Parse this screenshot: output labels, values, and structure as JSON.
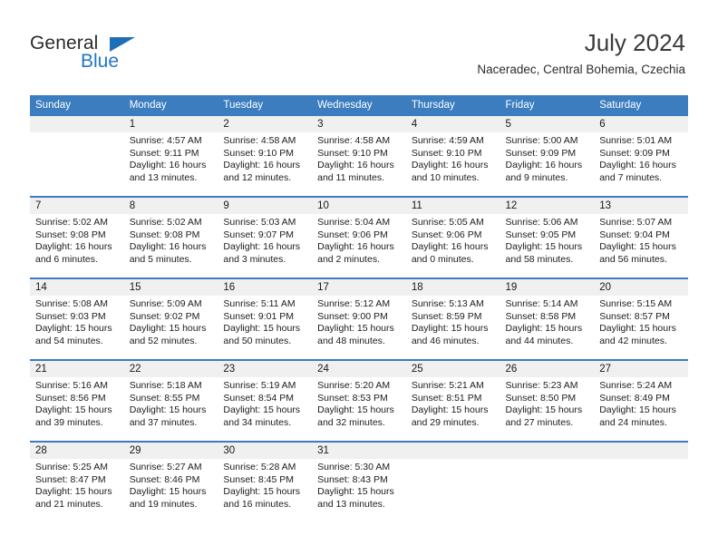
{
  "logo": {
    "word_one": "General",
    "word_two": "Blue",
    "accent_color": "#2077c4"
  },
  "header": {
    "title": "July 2024",
    "subtitle": "Naceradec, Central Bohemia, Czechia",
    "header_bg": "#3b7dbf",
    "daynum_bg": "#f0f0f0"
  },
  "calendar": {
    "weekday_headers": [
      "Sunday",
      "Monday",
      "Tuesday",
      "Wednesday",
      "Thursday",
      "Friday",
      "Saturday"
    ],
    "weeks": [
      [
        {
          "day": "",
          "lines": []
        },
        {
          "day": "1",
          "lines": [
            "Sunrise: 4:57 AM",
            "Sunset: 9:11 PM",
            "Daylight: 16 hours",
            "and 13 minutes."
          ]
        },
        {
          "day": "2",
          "lines": [
            "Sunrise: 4:58 AM",
            "Sunset: 9:10 PM",
            "Daylight: 16 hours",
            "and 12 minutes."
          ]
        },
        {
          "day": "3",
          "lines": [
            "Sunrise: 4:58 AM",
            "Sunset: 9:10 PM",
            "Daylight: 16 hours",
            "and 11 minutes."
          ]
        },
        {
          "day": "4",
          "lines": [
            "Sunrise: 4:59 AM",
            "Sunset: 9:10 PM",
            "Daylight: 16 hours",
            "and 10 minutes."
          ]
        },
        {
          "day": "5",
          "lines": [
            "Sunrise: 5:00 AM",
            "Sunset: 9:09 PM",
            "Daylight: 16 hours",
            "and 9 minutes."
          ]
        },
        {
          "day": "6",
          "lines": [
            "Sunrise: 5:01 AM",
            "Sunset: 9:09 PM",
            "Daylight: 16 hours",
            "and 7 minutes."
          ]
        }
      ],
      [
        {
          "day": "7",
          "lines": [
            "Sunrise: 5:02 AM",
            "Sunset: 9:08 PM",
            "Daylight: 16 hours",
            "and 6 minutes."
          ]
        },
        {
          "day": "8",
          "lines": [
            "Sunrise: 5:02 AM",
            "Sunset: 9:08 PM",
            "Daylight: 16 hours",
            "and 5 minutes."
          ]
        },
        {
          "day": "9",
          "lines": [
            "Sunrise: 5:03 AM",
            "Sunset: 9:07 PM",
            "Daylight: 16 hours",
            "and 3 minutes."
          ]
        },
        {
          "day": "10",
          "lines": [
            "Sunrise: 5:04 AM",
            "Sunset: 9:06 PM",
            "Daylight: 16 hours",
            "and 2 minutes."
          ]
        },
        {
          "day": "11",
          "lines": [
            "Sunrise: 5:05 AM",
            "Sunset: 9:06 PM",
            "Daylight: 16 hours",
            "and 0 minutes."
          ]
        },
        {
          "day": "12",
          "lines": [
            "Sunrise: 5:06 AM",
            "Sunset: 9:05 PM",
            "Daylight: 15 hours",
            "and 58 minutes."
          ]
        },
        {
          "day": "13",
          "lines": [
            "Sunrise: 5:07 AM",
            "Sunset: 9:04 PM",
            "Daylight: 15 hours",
            "and 56 minutes."
          ]
        }
      ],
      [
        {
          "day": "14",
          "lines": [
            "Sunrise: 5:08 AM",
            "Sunset: 9:03 PM",
            "Daylight: 15 hours",
            "and 54 minutes."
          ]
        },
        {
          "day": "15",
          "lines": [
            "Sunrise: 5:09 AM",
            "Sunset: 9:02 PM",
            "Daylight: 15 hours",
            "and 52 minutes."
          ]
        },
        {
          "day": "16",
          "lines": [
            "Sunrise: 5:11 AM",
            "Sunset: 9:01 PM",
            "Daylight: 15 hours",
            "and 50 minutes."
          ]
        },
        {
          "day": "17",
          "lines": [
            "Sunrise: 5:12 AM",
            "Sunset: 9:00 PM",
            "Daylight: 15 hours",
            "and 48 minutes."
          ]
        },
        {
          "day": "18",
          "lines": [
            "Sunrise: 5:13 AM",
            "Sunset: 8:59 PM",
            "Daylight: 15 hours",
            "and 46 minutes."
          ]
        },
        {
          "day": "19",
          "lines": [
            "Sunrise: 5:14 AM",
            "Sunset: 8:58 PM",
            "Daylight: 15 hours",
            "and 44 minutes."
          ]
        },
        {
          "day": "20",
          "lines": [
            "Sunrise: 5:15 AM",
            "Sunset: 8:57 PM",
            "Daylight: 15 hours",
            "and 42 minutes."
          ]
        }
      ],
      [
        {
          "day": "21",
          "lines": [
            "Sunrise: 5:16 AM",
            "Sunset: 8:56 PM",
            "Daylight: 15 hours",
            "and 39 minutes."
          ]
        },
        {
          "day": "22",
          "lines": [
            "Sunrise: 5:18 AM",
            "Sunset: 8:55 PM",
            "Daylight: 15 hours",
            "and 37 minutes."
          ]
        },
        {
          "day": "23",
          "lines": [
            "Sunrise: 5:19 AM",
            "Sunset: 8:54 PM",
            "Daylight: 15 hours",
            "and 34 minutes."
          ]
        },
        {
          "day": "24",
          "lines": [
            "Sunrise: 5:20 AM",
            "Sunset: 8:53 PM",
            "Daylight: 15 hours",
            "and 32 minutes."
          ]
        },
        {
          "day": "25",
          "lines": [
            "Sunrise: 5:21 AM",
            "Sunset: 8:51 PM",
            "Daylight: 15 hours",
            "and 29 minutes."
          ]
        },
        {
          "day": "26",
          "lines": [
            "Sunrise: 5:23 AM",
            "Sunset: 8:50 PM",
            "Daylight: 15 hours",
            "and 27 minutes."
          ]
        },
        {
          "day": "27",
          "lines": [
            "Sunrise: 5:24 AM",
            "Sunset: 8:49 PM",
            "Daylight: 15 hours",
            "and 24 minutes."
          ]
        }
      ],
      [
        {
          "day": "28",
          "lines": [
            "Sunrise: 5:25 AM",
            "Sunset: 8:47 PM",
            "Daylight: 15 hours",
            "and 21 minutes."
          ]
        },
        {
          "day": "29",
          "lines": [
            "Sunrise: 5:27 AM",
            "Sunset: 8:46 PM",
            "Daylight: 15 hours",
            "and 19 minutes."
          ]
        },
        {
          "day": "30",
          "lines": [
            "Sunrise: 5:28 AM",
            "Sunset: 8:45 PM",
            "Daylight: 15 hours",
            "and 16 minutes."
          ]
        },
        {
          "day": "31",
          "lines": [
            "Sunrise: 5:30 AM",
            "Sunset: 8:43 PM",
            "Daylight: 15 hours",
            "and 13 minutes."
          ]
        },
        {
          "day": "",
          "lines": []
        },
        {
          "day": "",
          "lines": []
        },
        {
          "day": "",
          "lines": []
        }
      ]
    ]
  }
}
